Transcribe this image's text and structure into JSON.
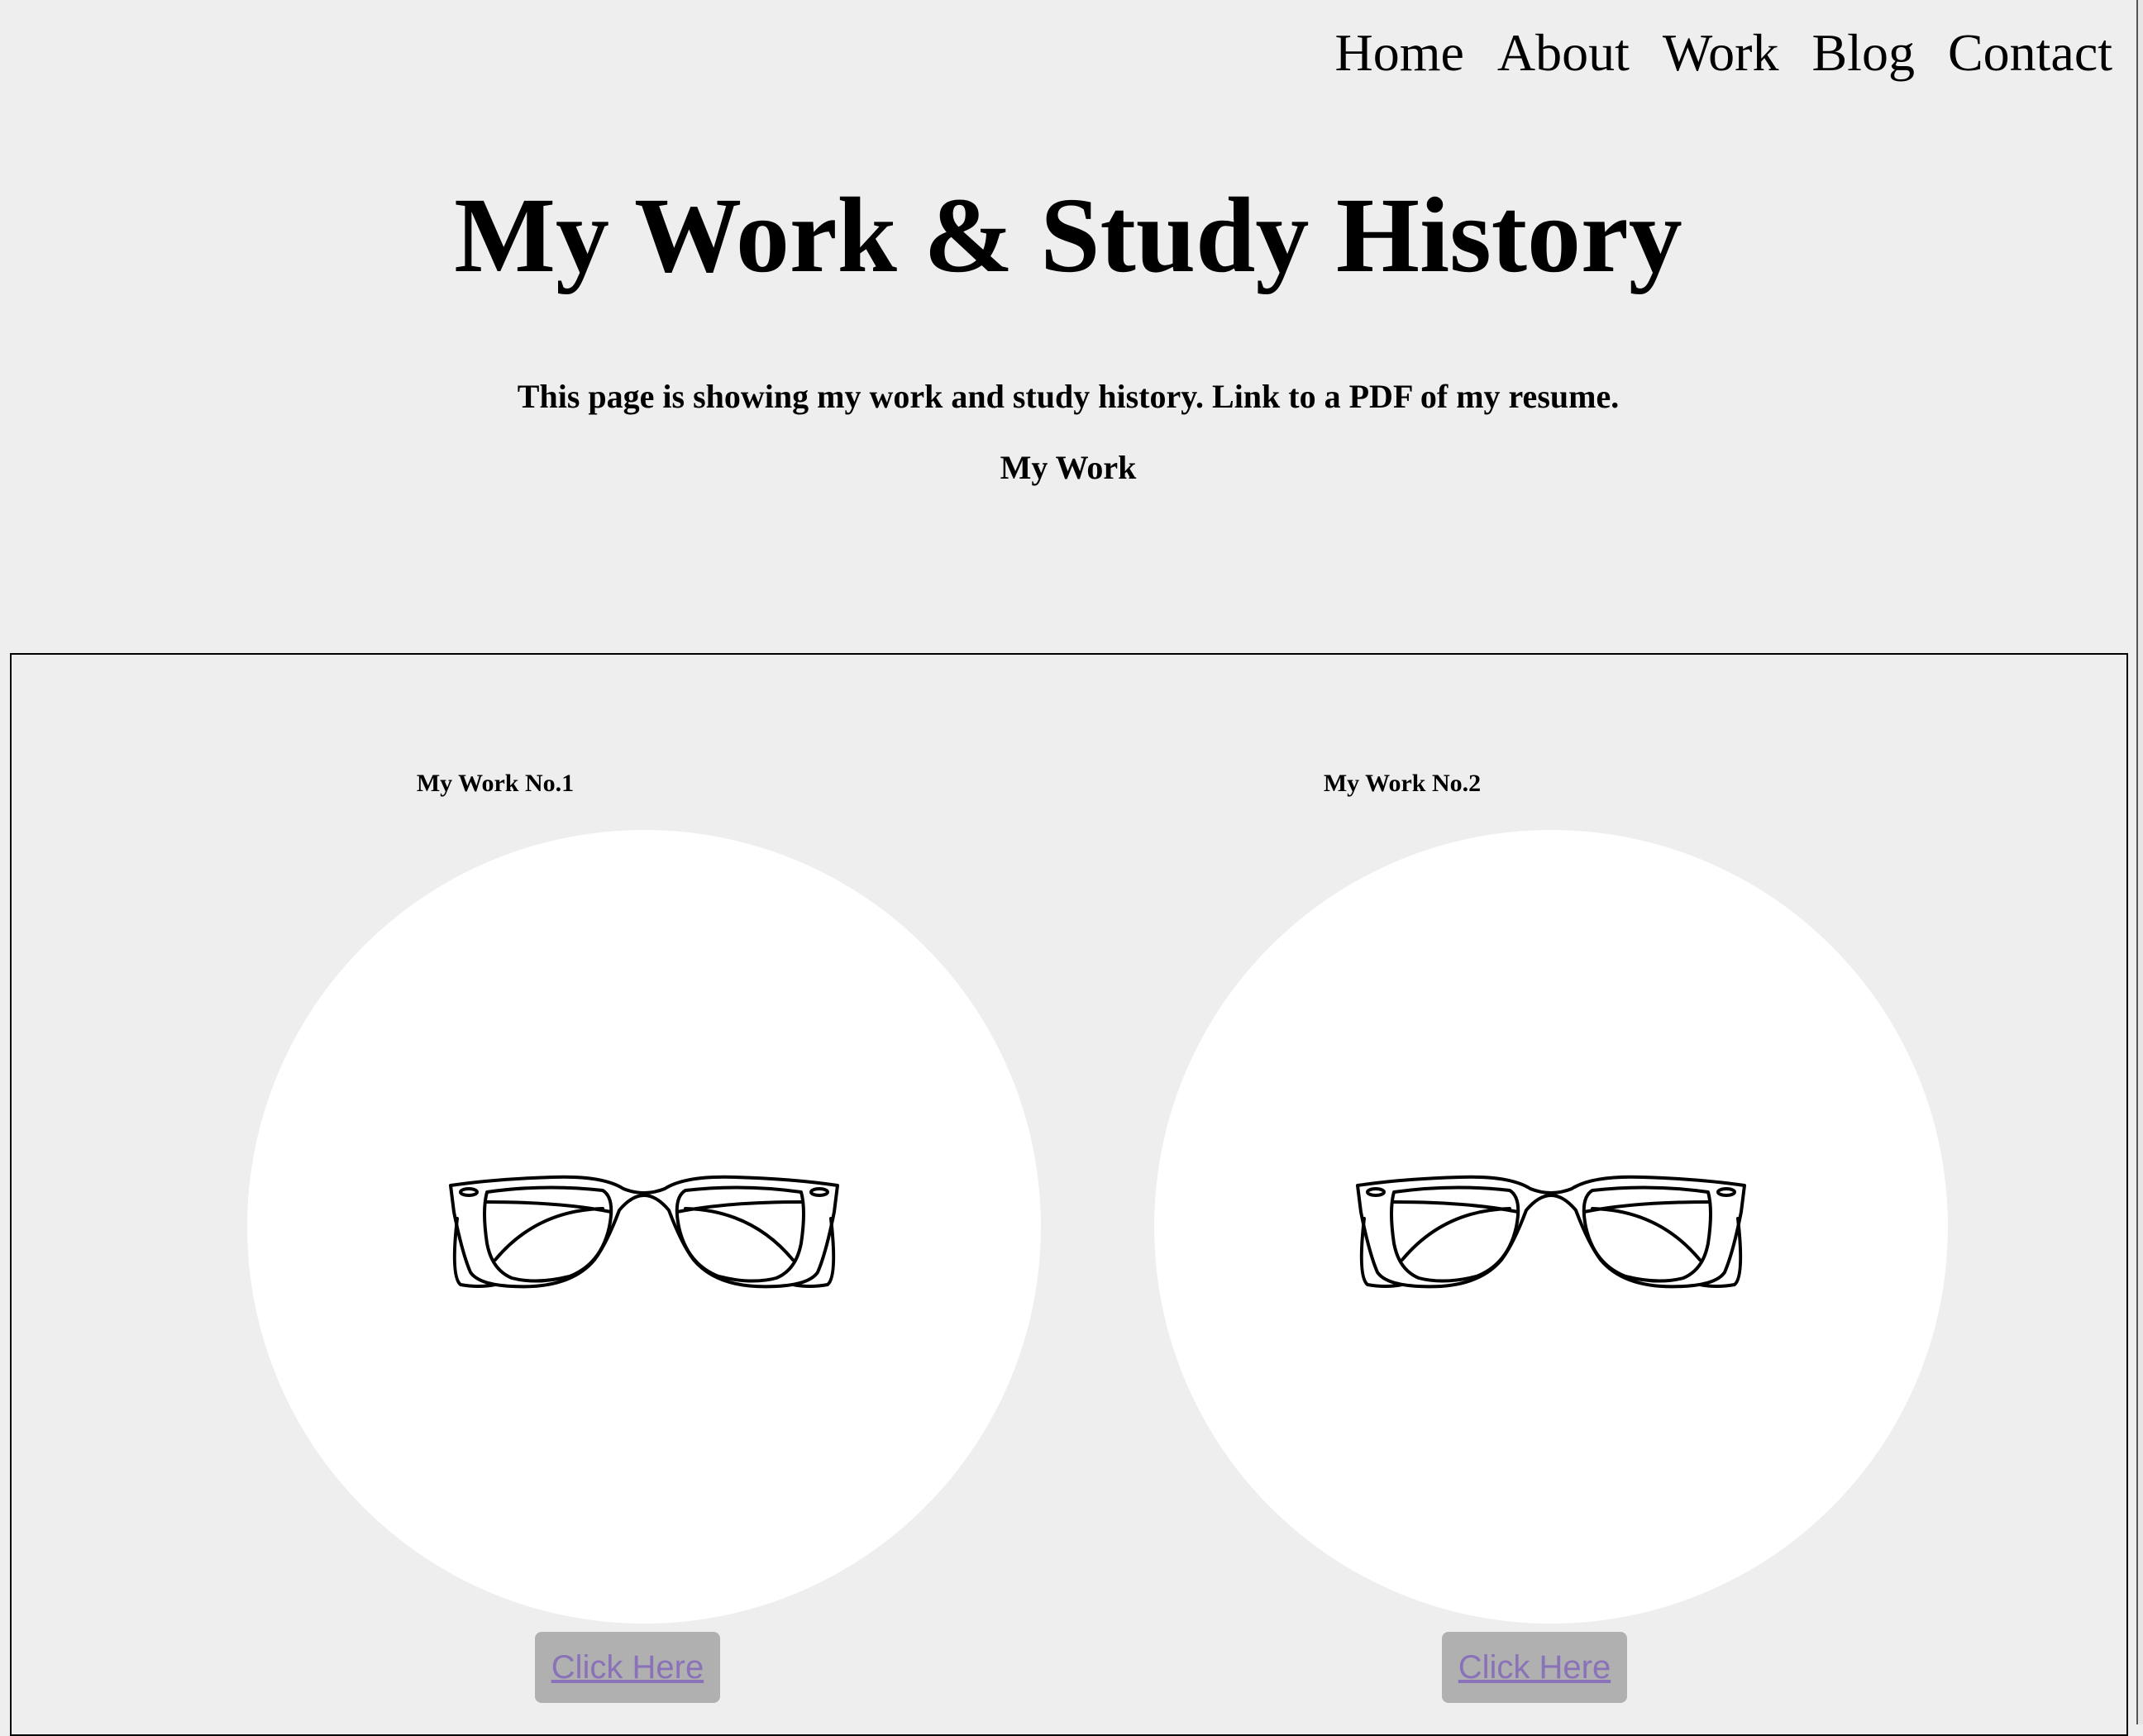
{
  "nav": {
    "items": [
      {
        "label": "Home"
      },
      {
        "label": "About"
      },
      {
        "label": "Work"
      },
      {
        "label": "Blog"
      },
      {
        "label": "Contact"
      }
    ]
  },
  "header": {
    "title": "My Work & Study History",
    "intro": "This page is showing my work and study history. Link to a PDF of my resume.",
    "section_heading": "My Work"
  },
  "work": {
    "items": [
      {
        "label": "My Work No.1",
        "image_icon": "glasses-icon",
        "button_label": "Click Here"
      },
      {
        "label": "My Work No.2",
        "image_icon": "glasses-icon",
        "button_label": "Click Here"
      }
    ]
  },
  "colors": {
    "background": "#eeeeee",
    "image_background": "#ffffff",
    "button_background": "#b0b0b0",
    "link_visited": "#8a72b8"
  }
}
